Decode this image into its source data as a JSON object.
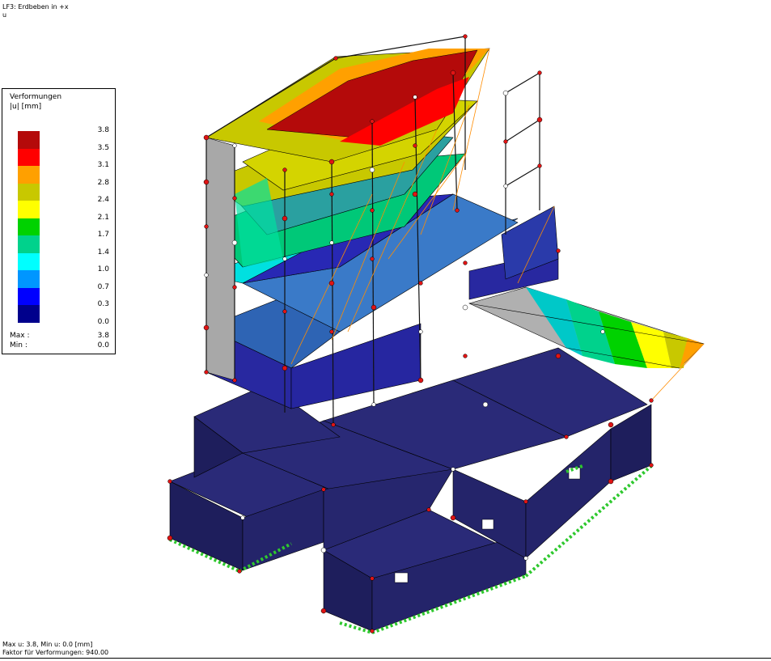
{
  "header": {
    "load_case": "LF3: Erdbeben in +x",
    "component": "u"
  },
  "legend": {
    "title": "Verformungen",
    "unit": "|u| [mm]",
    "scale": [
      {
        "value": "3.8",
        "color": "#b40a0a"
      },
      {
        "value": "3.5",
        "color": "#ff0000"
      },
      {
        "value": "3.1",
        "color": "#ffa000"
      },
      {
        "value": "2.8",
        "color": "#c8c800"
      },
      {
        "value": "2.4",
        "color": "#ffff00"
      },
      {
        "value": "2.1",
        "color": "#00d200"
      },
      {
        "value": "1.7",
        "color": "#00d28c"
      },
      {
        "value": "1.4",
        "color": "#00ffff"
      },
      {
        "value": "1.0",
        "color": "#0096ff"
      },
      {
        "value": "0.7",
        "color": "#0000ff"
      },
      {
        "value": "0.3",
        "color": "#00008c"
      },
      {
        "value": "0.0",
        "color": ""
      }
    ],
    "max_label": "Max :",
    "max_value": "3.8",
    "min_label": "Min :",
    "min_value": "0.0"
  },
  "footer": {
    "range": "Max u: 3.8, Min u: 0.0 [mm]",
    "factor": "Faktor für Verformungen: 940.00"
  },
  "colors": {
    "base_slab": "#26266e",
    "base_dark": "#1a1a55",
    "support": "#2ec82e",
    "node": "#e01414",
    "beam": "#111111"
  }
}
